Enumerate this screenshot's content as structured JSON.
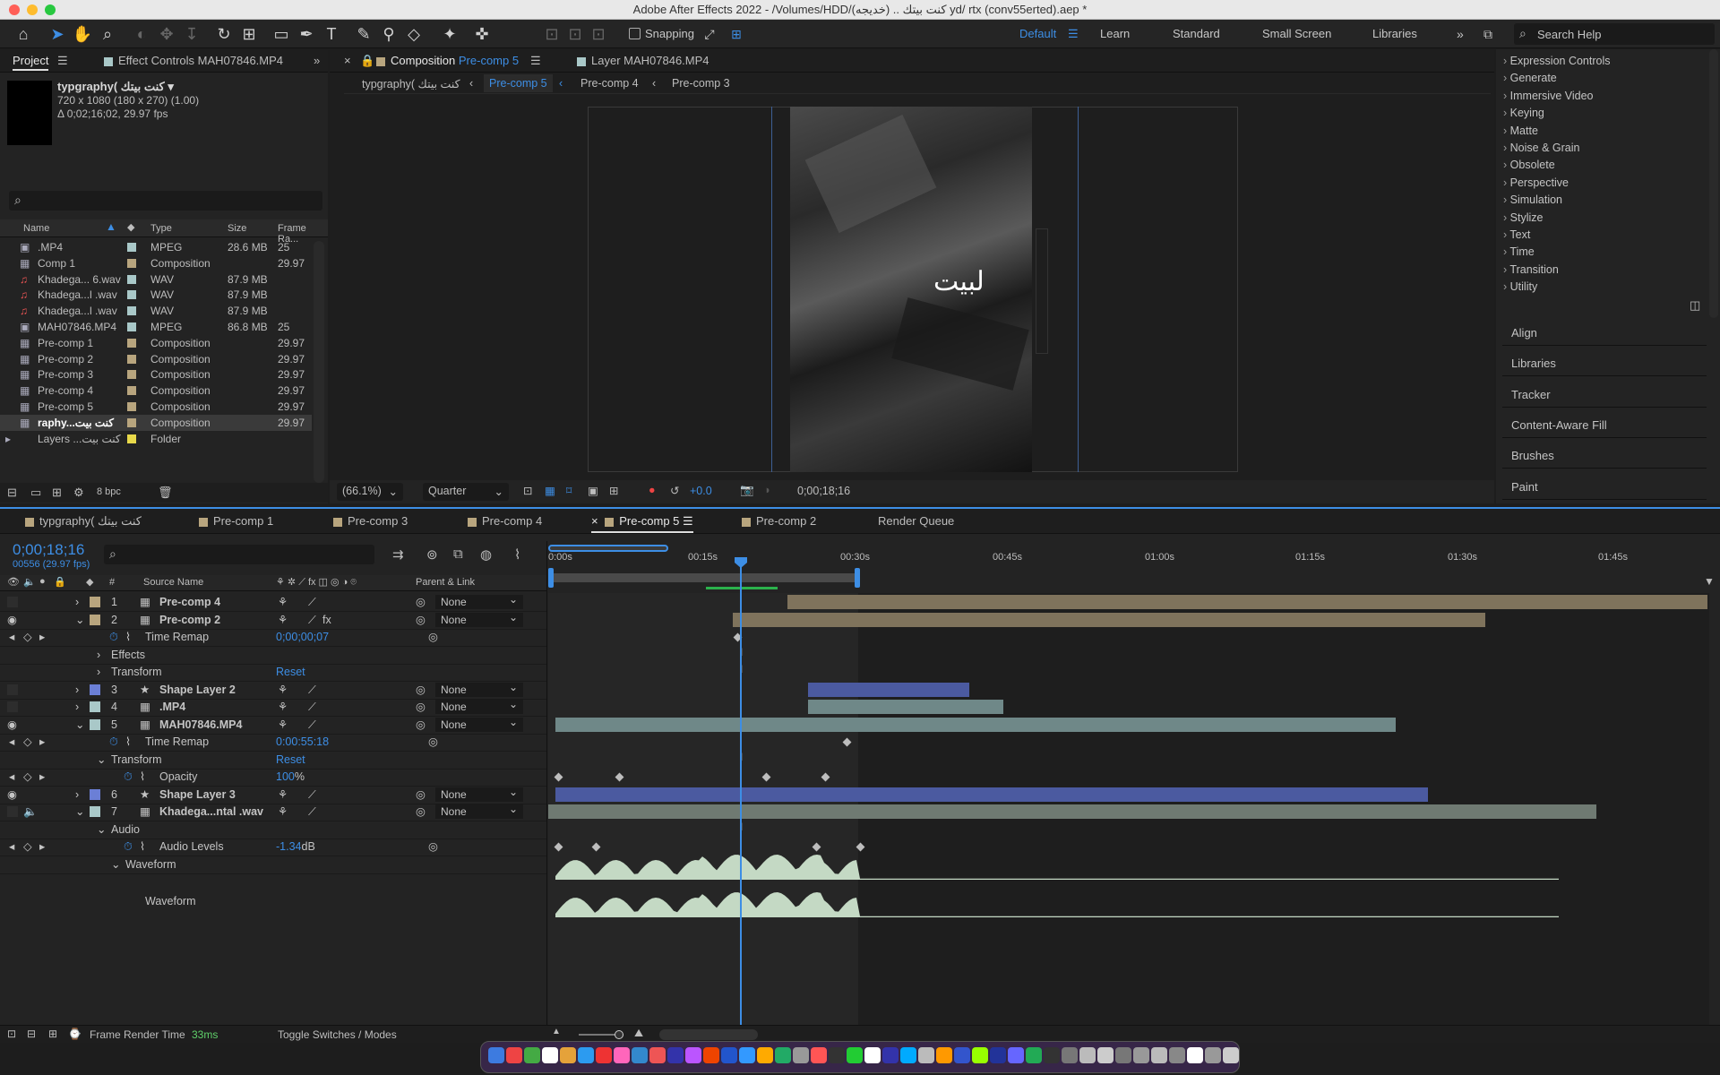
{
  "window": {
    "title": "Adobe After Effects 2022 - /Volumes/HDD/(خديجه) .. كنت بيتك yd/ rtx (conv55erted).aep *"
  },
  "toolbar": {
    "snapping": "Snapping",
    "workspaces": [
      "Default",
      "Learn",
      "Standard",
      "Small Screen",
      "Libraries"
    ],
    "search_placeholder": "Search Help"
  },
  "project": {
    "tab": "Project",
    "effect_controls_tab": "Effect Controls MAH07846.MP4",
    "item_name": "typgraphy( كنت بيتك ▾",
    "item_dims": "720 x 1080  (180 x 270) (1.00)",
    "item_duration": "Δ 0;02;16;02, 29.97 fps",
    "columns": [
      "Name",
      "Type",
      "Size",
      "Frame Ra..."
    ],
    "items": [
      {
        "name": ".MP4",
        "type": "MPEG",
        "size": "28.6 MB",
        "fr": "25",
        "color": "#a9c8c8",
        "icon": "video"
      },
      {
        "name": "Comp 1",
        "type": "Composition",
        "size": "",
        "fr": "29.97",
        "color": "#b8a57e",
        "icon": "comp"
      },
      {
        "name": "Khadega... 6.wav",
        "type": "WAV",
        "size": "87.9 MB",
        "fr": "",
        "color": "#a9c8c8",
        "icon": "audio"
      },
      {
        "name": "Khadega...l .wav",
        "type": "WAV",
        "size": "87.9 MB",
        "fr": "",
        "color": "#a9c8c8",
        "icon": "audio"
      },
      {
        "name": "Khadega...l .wav",
        "type": "WAV",
        "size": "87.9 MB",
        "fr": "",
        "color": "#a9c8c8",
        "icon": "audio"
      },
      {
        "name": "MAH07846.MP4",
        "type": "MPEG",
        "size": "86.8 MB",
        "fr": "25",
        "color": "#a9c8c8",
        "icon": "video"
      },
      {
        "name": "Pre-comp 1",
        "type": "Composition",
        "size": "",
        "fr": "29.97",
        "color": "#b8a57e",
        "icon": "comp"
      },
      {
        "name": "Pre-comp 2",
        "type": "Composition",
        "size": "",
        "fr": "29.97",
        "color": "#b8a57e",
        "icon": "comp"
      },
      {
        "name": "Pre-comp 3",
        "type": "Composition",
        "size": "",
        "fr": "29.97",
        "color": "#b8a57e",
        "icon": "comp"
      },
      {
        "name": "Pre-comp 4",
        "type": "Composition",
        "size": "",
        "fr": "29.97",
        "color": "#b8a57e",
        "icon": "comp"
      },
      {
        "name": "Pre-comp 5",
        "type": "Composition",
        "size": "",
        "fr": "29.97",
        "color": "#b8a57e",
        "icon": "comp"
      },
      {
        "name": "raphy...كنت بيت",
        "type": "Composition",
        "size": "",
        "fr": "29.97",
        "color": "#b8a57e",
        "icon": "comp"
      },
      {
        "name": "Layers ...كنت بيت",
        "type": "Folder",
        "size": "",
        "fr": "",
        "color": "#e8d94a",
        "icon": "folder"
      }
    ],
    "bpc": "8 bpc"
  },
  "comp": {
    "tab_label": "Composition",
    "tab_name": "Pre-comp 5",
    "layer_tab": "Layer MAH07846.MP4",
    "breadcrumbs": [
      "typgraphy( كنت بيتك",
      "Pre-comp 5",
      "Pre-comp 4",
      "Pre-comp 3"
    ],
    "zoom": "(66.1%)",
    "quality": "Quarter",
    "exposure": "+0.0",
    "timecode": "0;00;18;16",
    "subtitle_text": "لبيت"
  },
  "effects": {
    "items": [
      "Expression Controls",
      "Generate",
      "Immersive Video",
      "Keying",
      "Matte",
      "Noise & Grain",
      "Obsolete",
      "Perspective",
      "Simulation",
      "Stylize",
      "Text",
      "Time",
      "Transition",
      "Utility"
    ],
    "panels": [
      "Align",
      "Libraries",
      "Tracker",
      "Content-Aware Fill",
      "Brushes",
      "Paint"
    ]
  },
  "timeline": {
    "tabs": [
      "typgraphy( كنت بيتك",
      "Pre-comp 1",
      "Pre-comp 3",
      "Pre-comp 4",
      "Pre-comp 5",
      "Pre-comp 2",
      "Render Queue"
    ],
    "active_tab": "Pre-comp 5",
    "timecode": "0;00;18;16",
    "frames": "00556 (29.97 fps)",
    "col_hash": "#",
    "col_source": "Source Name",
    "col_parent": "Parent & Link",
    "ruler": [
      "0:00s",
      "00:15s",
      "00:30s",
      "00:45s",
      "01:00s",
      "01:15s",
      "01:30s",
      "01:45s"
    ],
    "layers": [
      {
        "num": "1",
        "name": "Pre-comp 4",
        "parent": "None",
        "color": "#b8a57e"
      },
      {
        "num": "2",
        "name": "Pre-comp 2",
        "parent": "None",
        "color": "#b8a57e"
      },
      {
        "num": "3",
        "name": "Shape Layer 2",
        "parent": "None",
        "color": "#6b7fd6"
      },
      {
        "num": "4",
        "name": ".MP4",
        "parent": "None",
        "color": "#a9c8c8"
      },
      {
        "num": "5",
        "name": "MAH07846.MP4",
        "parent": "None",
        "color": "#a9c8c8"
      },
      {
        "num": "6",
        "name": "Shape Layer 3",
        "parent": "None",
        "color": "#6b7fd6"
      },
      {
        "num": "7",
        "name": "Khadega...ntal .wav",
        "parent": "None",
        "color": "#a9c8c8"
      }
    ],
    "props": {
      "time_remap_label": "Time Remap",
      "time_remap_1": "0;00;00;07",
      "effects": "Effects",
      "transform": "Transform",
      "reset": "Reset",
      "time_remap_2": "0:00:55:18",
      "opacity_label": "Opacity",
      "opacity": "100",
      "pct": "%",
      "audio": "Audio",
      "audio_levels_label": "Audio Levels",
      "audio_levels": "-1.34",
      "db": "dB",
      "waveform": "Waveform"
    },
    "footer_render": "Frame Render Time",
    "footer_ms": "33ms",
    "toggle": "Toggle Switches / Modes"
  }
}
